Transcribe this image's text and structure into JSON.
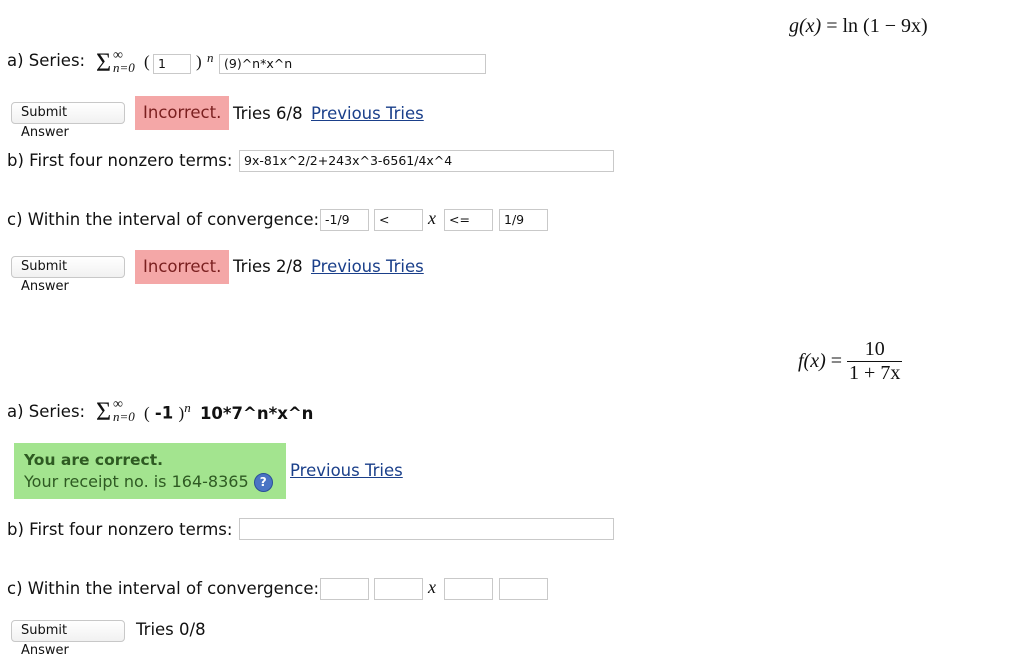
{
  "problem1": {
    "function": {
      "lhs": "g(x)",
      "eq": "=",
      "rhs": "ln (1 − 9x)"
    },
    "part_a": {
      "label": "a) Series:",
      "sigma": "Σ",
      "sup": "∞",
      "sub": "n=0",
      "open_paren": "(",
      "close_paren": ")",
      "exp": "n",
      "base_input_value": "1",
      "term_input_value": "(9)^n*x^n"
    },
    "submit1": {
      "button_label": "Submit Answer",
      "status": "Incorrect.",
      "tries": "Tries 6/8",
      "previous_link": "Previous Tries"
    },
    "part_b": {
      "label": "b) First four nonzero terms:",
      "input_value": "9x-81x^2/2+243x^3-6561/4x^4"
    },
    "part_c": {
      "label": "c) Within the interval of convergence:",
      "lower_value": "-1/9",
      "lower_op": "<",
      "x": "x",
      "upper_op": "<=",
      "upper_value": "1/9"
    },
    "submit2": {
      "button_label": "Submit Answer",
      "status": "Incorrect.",
      "tries": "Tries 2/8",
      "previous_link": "Previous Tries"
    }
  },
  "problem2": {
    "function": {
      "lhs": "f(x)",
      "eq": "=",
      "numerator": "10",
      "denominator": "1 + 7x"
    },
    "part_a": {
      "label": "a) Series:",
      "sigma": "Σ",
      "sup": "∞",
      "sub": "n=0",
      "open_paren": "(",
      "base": "-1",
      "close_paren": ")",
      "exp": "n",
      "term": "10*7^n*x^n"
    },
    "correct": {
      "title": "You are correct.",
      "receipt": "Your receipt no. is 164-8365",
      "help_icon": "?",
      "previous_link": "Previous Tries"
    },
    "part_b": {
      "label": "b) First four nonzero terms:",
      "input_value": ""
    },
    "part_c": {
      "label": "c) Within the interval of convergence:",
      "x": "x"
    },
    "submit": {
      "button_label": "Submit Answer",
      "tries": "Tries 0/8"
    }
  }
}
